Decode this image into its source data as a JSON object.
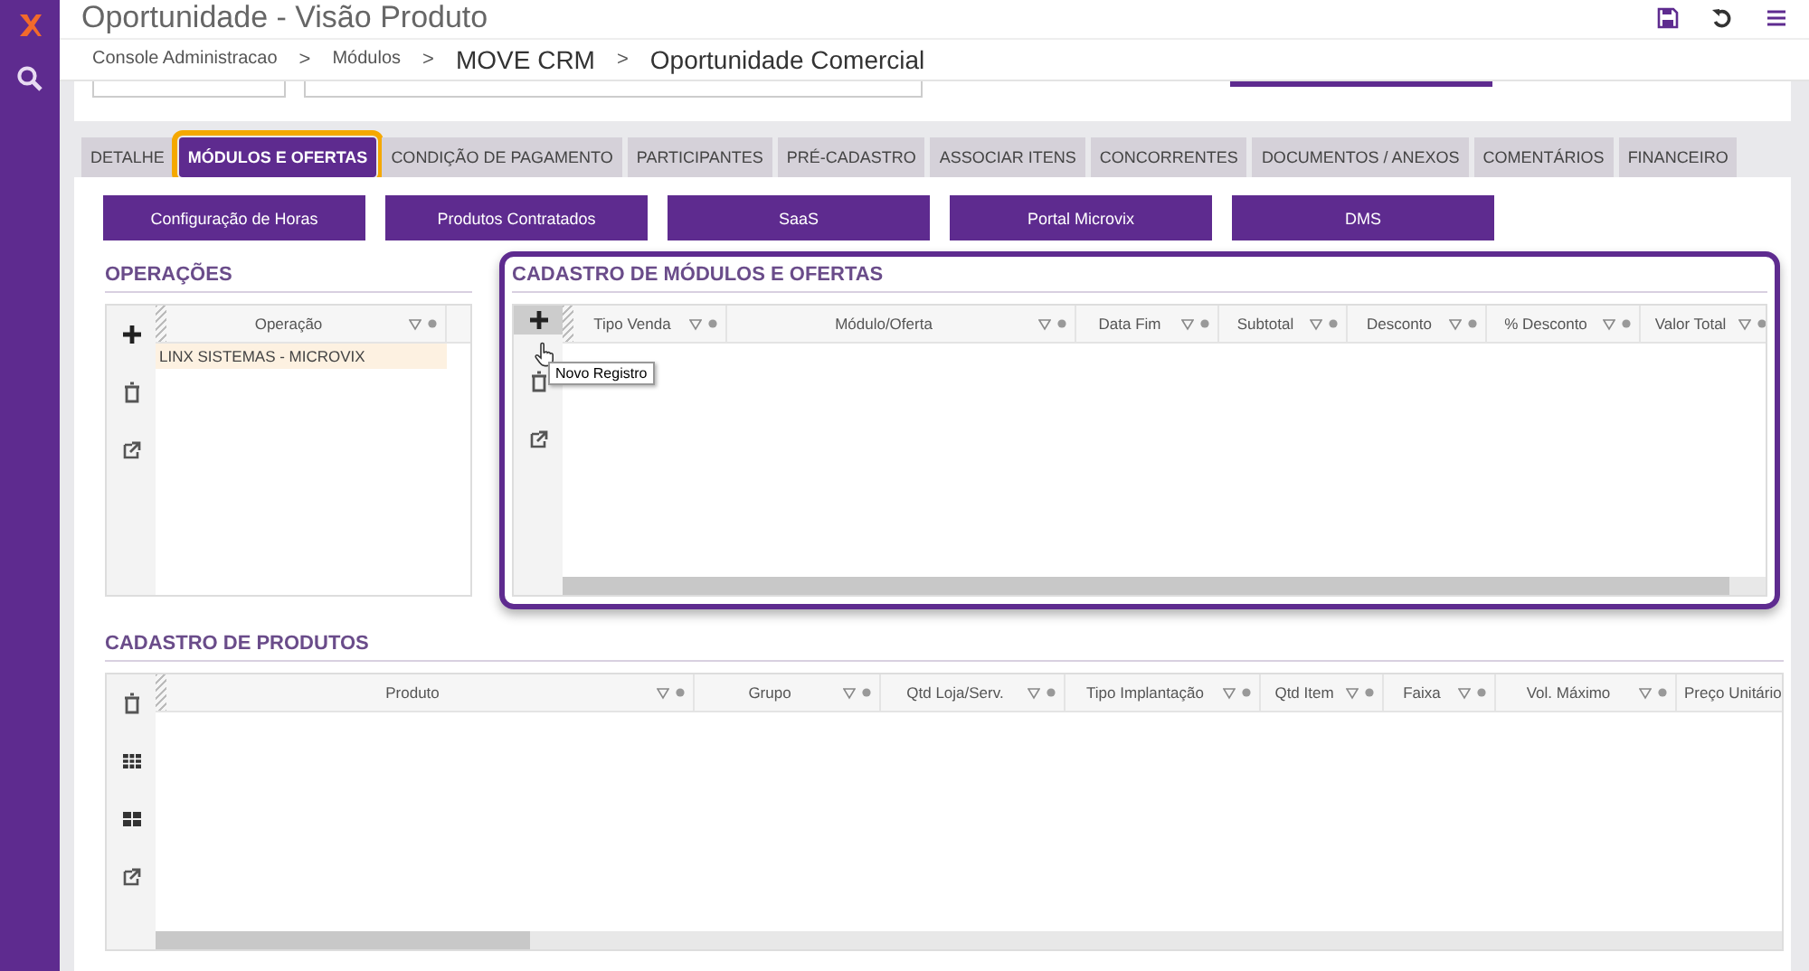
{
  "window": {
    "title": "Oportunidade - Visão Produto"
  },
  "breadcrumb": [
    {
      "label": "Console Administracao",
      "kind": "small"
    },
    {
      "label": ">",
      "kind": "sep"
    },
    {
      "label": "Módulos",
      "kind": "small"
    },
    {
      "label": ">",
      "kind": "sep"
    },
    {
      "label": "MOVE CRM",
      "kind": "large"
    },
    {
      "label": ">",
      "kind": "sep"
    },
    {
      "label": "Oportunidade  Comercial",
      "kind": "large"
    }
  ],
  "tabs": [
    {
      "label": "DETALHE",
      "selected": false,
      "highlighted": false
    },
    {
      "label": "MÓDULOS E OFERTAS",
      "selected": true,
      "highlighted": true
    },
    {
      "label": "CONDIÇÃO DE PAGAMENTO",
      "selected": false,
      "highlighted": false
    },
    {
      "label": "PARTICIPANTES",
      "selected": false,
      "highlighted": false
    },
    {
      "label": "PRÉ-CADASTRO",
      "selected": false,
      "highlighted": false
    },
    {
      "label": "ASSOCIAR ITENS",
      "selected": false,
      "highlighted": false
    },
    {
      "label": "CONCORRENTES",
      "selected": false,
      "highlighted": false
    },
    {
      "label": "DOCUMENTOS / ANEXOS",
      "selected": false,
      "highlighted": false
    },
    {
      "label": "COMENTÁRIOS",
      "selected": false,
      "highlighted": false
    },
    {
      "label": "FINANCEIRO",
      "selected": false,
      "highlighted": false
    }
  ],
  "buttons": [
    "Configuração de Horas",
    "Produtos Contratados",
    "SaaS",
    "Portal Microvix",
    "DMS"
  ],
  "operacoes": {
    "title": "OPERAÇÕES",
    "highlighted": false,
    "columns": [
      "Operação"
    ],
    "rows": [
      {
        "cells": [
          "LINX SISTEMAS - MICROVIX"
        ],
        "selected": true
      }
    ]
  },
  "modulos": {
    "title": "CADASTRO DE MÓDULOS E OFERTAS",
    "highlighted": true,
    "columns": [
      "Tipo Venda",
      "Módulo/Oferta",
      "Data Fim",
      "Subtotal",
      "Desconto",
      "% Desconto",
      "Valor Total"
    ],
    "tooltip": "Novo Registro"
  },
  "produtos": {
    "title": "CADASTRO DE PRODUTOS",
    "highlighted": false,
    "columns": [
      "Produto",
      "Grupo",
      "Qtd Loja/Serv.",
      "Tipo Implantação",
      "Qtd Item",
      "Faixa",
      "Vol. Máximo",
      "Preço Unitário"
    ]
  }
}
